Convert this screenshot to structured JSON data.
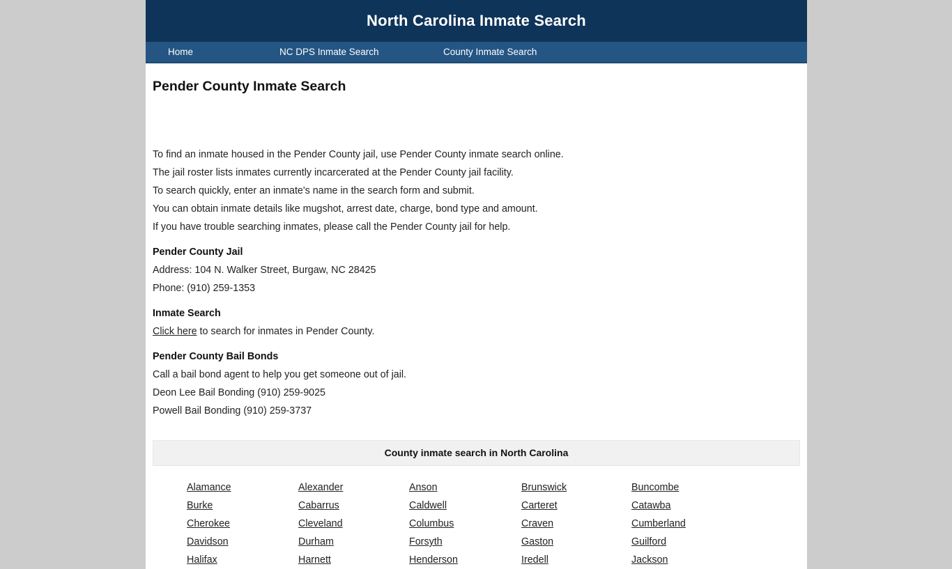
{
  "page": {
    "background_color": "#cccccc",
    "container_color": "#ffffff"
  },
  "header": {
    "title": "North Carolina Inmate Search",
    "background_color": "#0e3459",
    "text_color": "#ffffff"
  },
  "nav": {
    "background_color": "#245583",
    "items": [
      {
        "label": "Home"
      },
      {
        "label": "NC DPS Inmate Search"
      },
      {
        "label": "County Inmate Search"
      }
    ]
  },
  "main": {
    "heading": "Pender County Inmate Search",
    "intro_lines": [
      "To find an inmate housed in the Pender County jail, use Pender County inmate search online.",
      "The jail roster lists inmates currently incarcerated at the Pender County jail facility.",
      "To search quickly, enter an inmate's name in the search form and submit.",
      "You can obtain inmate details like mugshot, arrest date, charge, bond type and amount.",
      "If you have trouble searching inmates, please call the Pender County jail for help."
    ],
    "jail": {
      "title": "Pender County Jail",
      "address": "Address: 104 N. Walker Street, Burgaw, NC 28425",
      "phone": "Phone: (910) 259-1353"
    },
    "inmate_search": {
      "title": "Inmate Search",
      "link_label": "Click here",
      "link_suffix": " to search for inmates in Pender County."
    },
    "bail_bonds": {
      "title": "Pender County Bail Bonds",
      "description": "Call a bail bond agent to help you get someone out of jail.",
      "agents": [
        "Deon Lee Bail Bonding (910) 259-9025",
        "Powell Bail Bonding (910) 259-3737"
      ]
    }
  },
  "county_table": {
    "caption": "County inmate search in North Carolina",
    "counties": [
      "Alamance",
      "Alexander",
      "Anson",
      "Brunswick",
      "Buncombe",
      "Burke",
      "Cabarrus",
      "Caldwell",
      "Carteret",
      "Catawba",
      "Cherokee",
      "Cleveland",
      "Columbus",
      "Craven",
      "Cumberland",
      "Davidson",
      "Durham",
      "Forsyth",
      "Gaston",
      "Guilford",
      "Halifax",
      "Harnett",
      "Henderson",
      "Iredell",
      "Jackson"
    ]
  }
}
